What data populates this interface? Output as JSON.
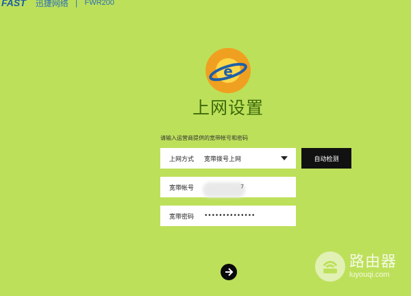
{
  "header": {
    "logo": "FAST",
    "brand_name": "迅捷网络",
    "separator": "|",
    "model": "FWR200"
  },
  "main": {
    "title": "上网设置",
    "hint": "请输入运营商提供的宽带帐号和密码",
    "connection_mode": {
      "label": "上网方式",
      "selected": "宽带拨号上网"
    },
    "account": {
      "label": "宽带帐号",
      "visible_tail": "7"
    },
    "password": {
      "label": "宽带密码",
      "value": "••••••••••••••"
    },
    "detect_button": "自动检测"
  },
  "watermark": {
    "title": "路由器",
    "subtitle": "luyouqi.com"
  },
  "colors": {
    "background": "#bde05a",
    "title": "#3a6a0a",
    "button": "#111111",
    "brand": "#2a6fb5"
  },
  "icons": {
    "logo": "planet-e-icon",
    "dropdown": "caret-down-icon",
    "next": "arrow-right-icon",
    "watermark": "router-icon"
  }
}
